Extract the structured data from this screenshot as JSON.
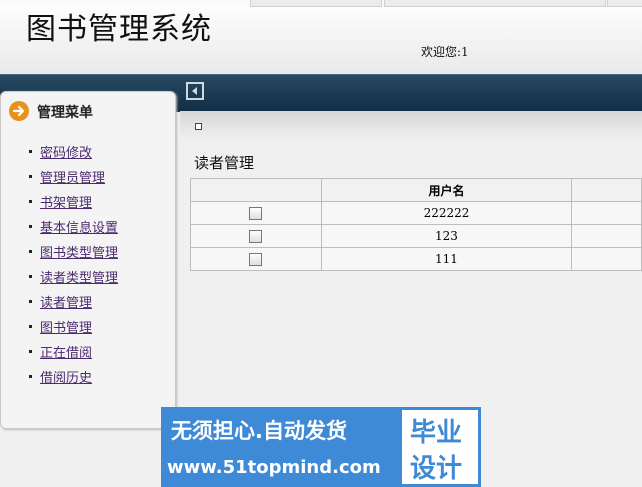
{
  "header": {
    "app_title": "图书管理系统",
    "welcome_text": "欢迎您:1"
  },
  "sidebar": {
    "title": "管理菜单",
    "items": [
      {
        "label": "密码修改"
      },
      {
        "label": "管理员管理"
      },
      {
        "label": "书架管理"
      },
      {
        "label": "基本信息设置"
      },
      {
        "label": "图书类型管理"
      },
      {
        "label": "读者类型管理"
      },
      {
        "label": "读者管理"
      },
      {
        "label": "图书管理"
      },
      {
        "label": "正在借阅"
      },
      {
        "label": "借阅历史"
      }
    ]
  },
  "main": {
    "section_title": "读者管理",
    "table": {
      "columns": [
        "",
        "用户名",
        ""
      ],
      "rows": [
        {
          "username": "222222",
          "checked": false
        },
        {
          "username": "123",
          "checked": false
        },
        {
          "username": "111",
          "checked": false
        }
      ]
    }
  },
  "watermark": {
    "line1": "无须担心.自动发货",
    "line2": "www.51topmind.com",
    "right_line1": "毕业",
    "right_line2": "设计"
  },
  "colors": {
    "navbar": "#0f2d44",
    "link": "#4b2a6e",
    "menu_icon": "#e8921c",
    "watermark_blue": "#3f8ad6"
  }
}
